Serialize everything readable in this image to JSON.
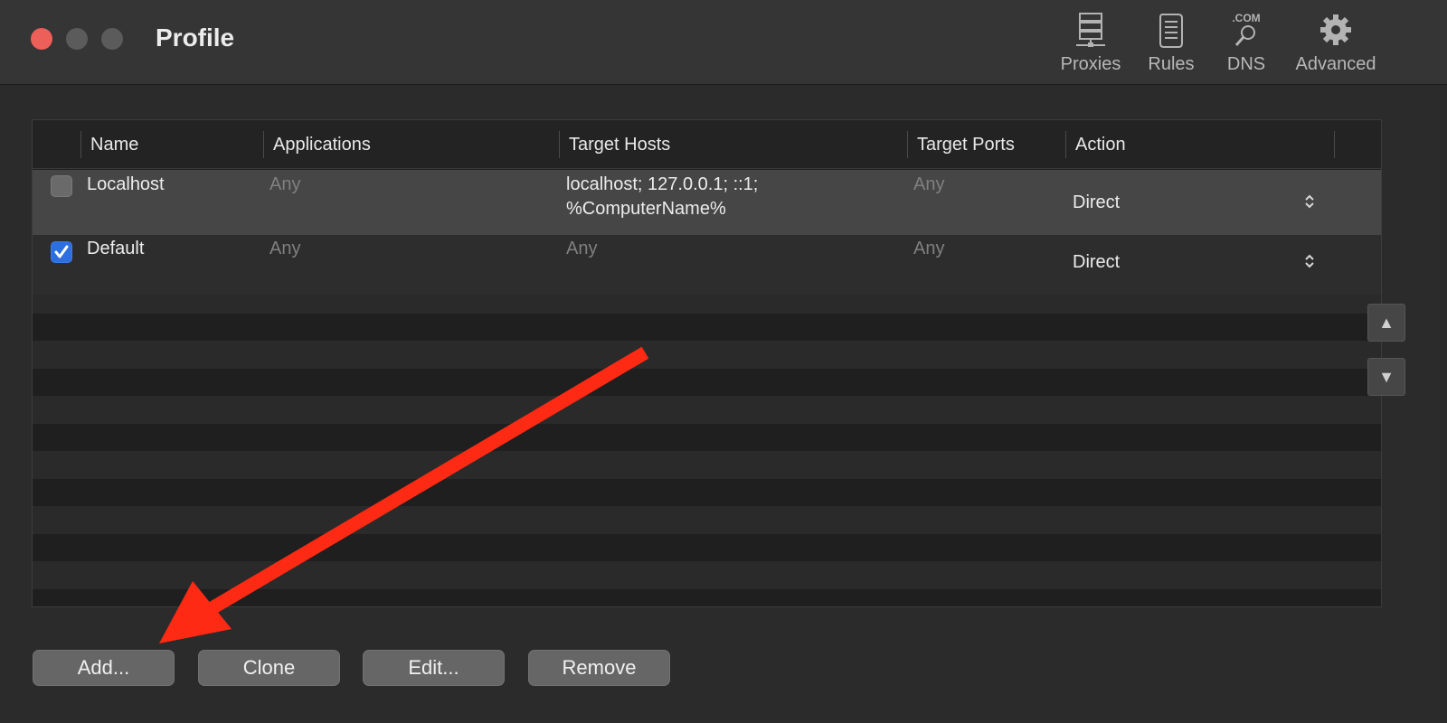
{
  "window": {
    "title": "Profile"
  },
  "toolbar": {
    "proxies": {
      "label": "Proxies",
      "icon": "server-icon"
    },
    "rules": {
      "label": "Rules",
      "icon": "scroll-icon"
    },
    "dns": {
      "label": "DNS",
      "badge": ".COM",
      "icon": "magnifier-icon"
    },
    "advanced": {
      "label": "Advanced",
      "icon": "gear-icon"
    }
  },
  "table": {
    "columns": [
      "Name",
      "Applications",
      "Target Hosts",
      "Target Ports",
      "Action"
    ],
    "rows": [
      {
        "checked": false,
        "name": "Localhost",
        "applications": "Any",
        "target_hosts_line1": "localhost; 127.0.0.1; ::1;",
        "target_hosts_line2": "%ComputerName%",
        "target_ports": "Any",
        "action": "Direct"
      },
      {
        "checked": true,
        "name": "Default",
        "applications": "Any",
        "target_hosts_line1": "Any",
        "target_ports": "Any",
        "action": "Direct"
      }
    ]
  },
  "move_buttons": {
    "up": "▲",
    "down": "▼"
  },
  "buttons": {
    "add": "Add...",
    "clone": "Clone",
    "edit": "Edit...",
    "remove": "Remove"
  },
  "colors": {
    "accent": "#2d6fe0",
    "annotation_arrow": "#ff2a14",
    "close_button": "#ed5f59"
  }
}
